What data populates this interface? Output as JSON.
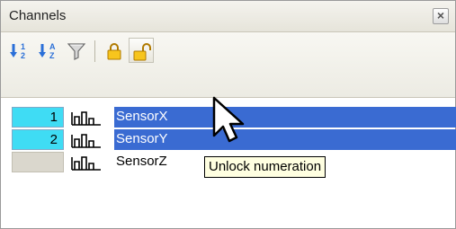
{
  "panel": {
    "title": "Channels",
    "close_glyph": "×"
  },
  "toolbar": {
    "buttons": [
      {
        "name": "sort-numeric-button",
        "icon": "sort-1-2-icon"
      },
      {
        "name": "sort-alpha-button",
        "icon": "sort-a-z-icon"
      },
      {
        "name": "filter-button",
        "icon": "funnel-icon"
      },
      {
        "name": "lock-numeration-button",
        "icon": "lock-closed-icon"
      },
      {
        "name": "unlock-numeration-button",
        "icon": "lock-open-icon"
      }
    ]
  },
  "channels": [
    {
      "number": "1",
      "name": "SensorX",
      "selected": true
    },
    {
      "number": "2",
      "name": "SensorY",
      "selected": true
    },
    {
      "number": "",
      "name": "SensorZ",
      "selected": false
    }
  ],
  "tooltip": {
    "text": "Unlock numeration"
  },
  "colors": {
    "selection": "#3a6bd2",
    "number_selected": "#3fdcf4",
    "tooltip_bg": "#ffffe1"
  }
}
